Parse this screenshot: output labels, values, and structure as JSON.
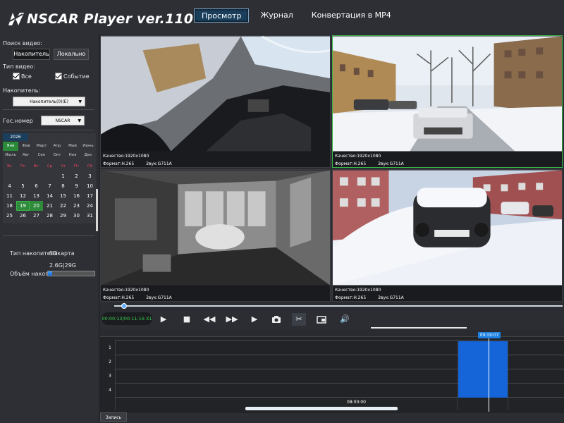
{
  "header": {
    "app_title": "NSCAR Player ver.110",
    "nav": [
      "Просмотр",
      "Журнал",
      "Конвертация в MP4"
    ]
  },
  "sidebar": {
    "search_label": "Поиск видео:",
    "source_drive": "Накопитель",
    "source_local": "Локально",
    "type_label": "Тип видео:",
    "type_all": "Все",
    "type_event": "Событие",
    "drive_label": "Накопитель:",
    "drive_select": "Накопитель(0)(E)",
    "plate_label": "Гос.номер",
    "plate_select": "NSCAR",
    "calendar": {
      "year": "2026",
      "months": [
        "Янв",
        "Фев",
        "Март",
        "Апр",
        "Май",
        "Июнь",
        "Июль",
        "Авг",
        "Сен",
        "Окт",
        "Ноя",
        "Дек"
      ],
      "active_month": 0,
      "dow": [
        "Вс",
        "Пн",
        "Вт",
        "Ср",
        "Чт",
        "Пт",
        "Сб"
      ],
      "days": [
        "",
        "",
        "",
        "",
        "1",
        "2",
        "3",
        "4",
        "5",
        "6",
        "7",
        "8",
        "9",
        "10",
        "11",
        "12",
        "13",
        "14",
        "15",
        "16",
        "17",
        "18",
        "19",
        "20",
        "21",
        "22",
        "23",
        "24",
        "25",
        "26",
        "27",
        "28",
        "29",
        "30",
        "31"
      ],
      "marked_days": [
        "19"
      ],
      "filled_days": [
        "19",
        "20"
      ]
    },
    "storage_type_label": "Тип накопителя",
    "storage_type_value": "SDкарта",
    "storage_size_value": "2.6G|29G",
    "storage_size_label": "Объём накоп.",
    "storage_used_fraction": 0.09
  },
  "cameras": [
    {
      "quality": "Качество:1920x1080",
      "format": "Формат:H.265",
      "sound": "Звук:G711A",
      "selected": false
    },
    {
      "quality": "Качество:1920x1080",
      "format": "Формат:H.265",
      "sound": "Звук:G711A",
      "selected": true
    },
    {
      "quality": "Качество:1920x1080",
      "format": "Формат:H.265",
      "sound": "Звук:G711A",
      "selected": false
    },
    {
      "quality": "Качество:1920x1080",
      "format": "Формат:H.265",
      "sound": "Звук:G711A",
      "selected": false
    }
  ],
  "player": {
    "time": "00:00:13/00:11:16 X1",
    "progress_fraction": 0.02,
    "icons": [
      "play-icon",
      "stop-icon",
      "rewind-icon",
      "fast-forward-icon",
      "next-frame-icon",
      "camera-icon",
      "scissors-icon",
      "export-icon",
      "volume-icon"
    ]
  },
  "timeline": {
    "rows": [
      "1",
      "2",
      "3",
      "4"
    ],
    "cursor_label": "09:19:07",
    "start_time": "08:00:00",
    "record_tab": "Запись"
  }
}
